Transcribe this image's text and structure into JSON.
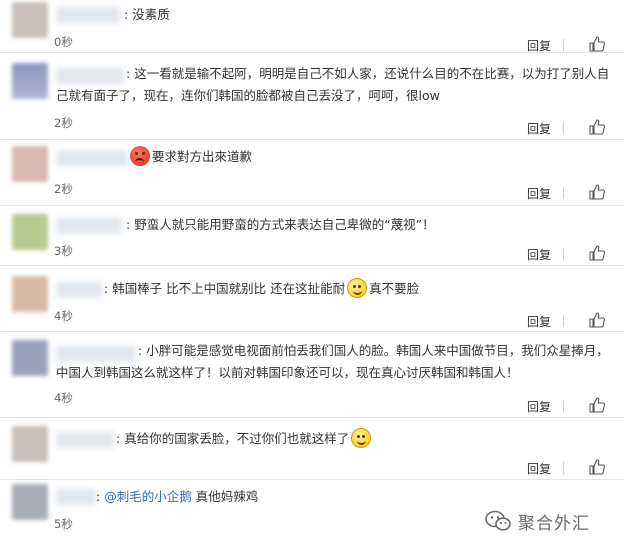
{
  "comments": [
    {
      "text": "没素质",
      "time": "0秒",
      "reply": "回复",
      "avatar_color": "#c8c0b8"
    },
    {
      "text": "这一看就是输不起阿，明明是自己不如人家，还说什么目的不在比赛，以为打了别人自己就有面子了，现在，连你们韩国的脸都被自己丢没了，呵呵，很low",
      "time": "2秒",
      "reply": "回复",
      "avatar_color": "#8d97c4"
    },
    {
      "text_after_emoji": "要求對方出來道歉",
      "time": "2秒",
      "reply": "回复",
      "avatar_color": "#d8b8b0",
      "emoji": "angry-face-emoji"
    },
    {
      "text": "野蛮人就只能用野蛮的方式来表达自己卑微的“蔑视”！",
      "time": "3秒",
      "reply": "回复",
      "avatar_color": "#b7c98e"
    },
    {
      "text_before_emoji": "韩国棒子 比不上中国就别比 还在这扯能耐",
      "text_after_emoji": "真不要脸",
      "time": "4秒",
      "reply": "回复",
      "avatar_color": "#d9b9a4",
      "emoji": "smile-face-emoji"
    },
    {
      "text": "小胖可能是感觉电视面前怕丢我们国人的脸。韩国人来中国做节目，我们众星捧月，中国人到韩国这么就这样了！以前对韩国印象还可以，现在真心讨厌韩国和韩国人！",
      "time": "4秒",
      "reply": "回复",
      "avatar_color": "#9aa0b8"
    },
    {
      "text_before_emoji": "真给你的国家丢脸，不过你们也就这样了",
      "time": "",
      "reply": "回复",
      "avatar_color": "#c7bfb8",
      "emoji": "smile-face-emoji"
    },
    {
      "mention": "@刺毛的小企鹅",
      "text": "真他妈辣鸡",
      "time": "5秒",
      "avatar_color": "#a8adb5"
    }
  ],
  "separator": ":",
  "watermark": {
    "label": "聚合外汇",
    "icon": "wechat-icon"
  },
  "colors": {
    "mention": "#3f6ab3",
    "text": "#333333",
    "meta": "#666666"
  }
}
